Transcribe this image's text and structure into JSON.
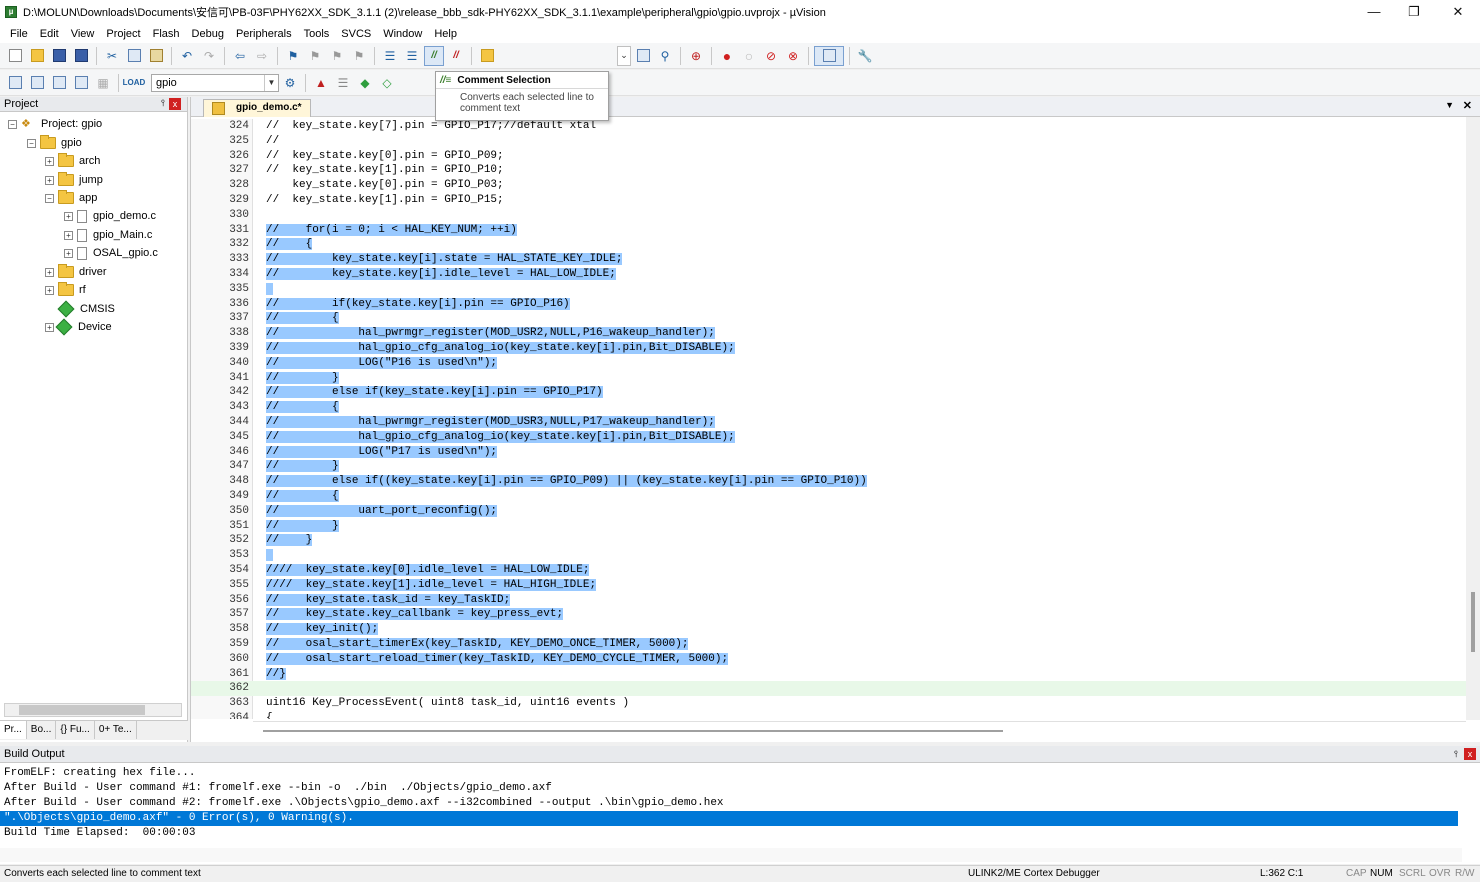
{
  "window": {
    "title": "D:\\MOLUN\\Downloads\\Documents\\安信可\\PB-03F\\PHY62XX_SDK_3.1.1 (2)\\release_bbb_sdk-PHY62XX_SDK_3.1.1\\example\\peripheral\\gpio\\gpio.uvprojx - µVision",
    "minimize": "—",
    "maximize": "❐",
    "close": "✕"
  },
  "menu": [
    "File",
    "Edit",
    "View",
    "Project",
    "Flash",
    "Debug",
    "Peripherals",
    "Tools",
    "SVCS",
    "Window",
    "Help"
  ],
  "toolbar2": {
    "target": "gpio"
  },
  "tooltip": {
    "icon": "//≡",
    "title": "Comment Selection",
    "body_line1": "Converts each selected line to",
    "body_line2": "comment text"
  },
  "project_panel": {
    "title": "Project",
    "pin": "⫯",
    "close": "x",
    "tree": [
      {
        "label": "Project: gpio",
        "level": 0
      },
      {
        "label": "gpio",
        "level": 1
      },
      {
        "label": "arch",
        "level": 2
      },
      {
        "label": "jump",
        "level": 2
      },
      {
        "label": "app",
        "level": 2
      },
      {
        "label": "gpio_demo.c",
        "level": 3
      },
      {
        "label": "gpio_Main.c",
        "level": 3
      },
      {
        "label": "OSAL_gpio.c",
        "level": 3
      },
      {
        "label": "driver",
        "level": 2
      },
      {
        "label": "rf",
        "level": 2
      },
      {
        "label": "CMSIS",
        "level": 2
      },
      {
        "label": "Device",
        "level": 2
      }
    ],
    "tabs": [
      "Pr...",
      "Bo...",
      "{} Fu...",
      "0+ Te..."
    ]
  },
  "editor": {
    "tab_label": "gpio_demo.c*",
    "lines": [
      {
        "n": "324",
        "pre": "//  key_state.key[7].pin = GPIO_P17;//default xtal",
        "sel": ""
      },
      {
        "n": "325",
        "pre": "//",
        "sel": ""
      },
      {
        "n": "326",
        "pre": "//  key_state.key[0].pin = GPIO_P09;",
        "sel": ""
      },
      {
        "n": "327",
        "pre": "//  key_state.key[1].pin = GPIO_P10;",
        "sel": ""
      },
      {
        "n": "328",
        "pre": "    key_state.key[0].pin = GPIO_P03;",
        "sel": ""
      },
      {
        "n": "329",
        "pre": "//  key_state.key[1].pin = GPIO_P15;",
        "sel": ""
      },
      {
        "n": "330",
        "pre": "",
        "sel": ""
      },
      {
        "n": "331",
        "pre": "",
        "sel": "//    for(i = 0; i < HAL_KEY_NUM; ++i)"
      },
      {
        "n": "332",
        "pre": "",
        "sel": "//    {"
      },
      {
        "n": "333",
        "pre": "",
        "sel": "//        key_state.key[i].state = HAL_STATE_KEY_IDLE;"
      },
      {
        "n": "334",
        "pre": "",
        "sel": "//        key_state.key[i].idle_level = HAL_LOW_IDLE;"
      },
      {
        "n": "335",
        "pre": "",
        "sel": " "
      },
      {
        "n": "336",
        "pre": "",
        "sel": "//        if(key_state.key[i].pin == GPIO_P16)"
      },
      {
        "n": "337",
        "pre": "",
        "sel": "//        {"
      },
      {
        "n": "338",
        "pre": "",
        "sel": "//            hal_pwrmgr_register(MOD_USR2,NULL,P16_wakeup_handler);"
      },
      {
        "n": "339",
        "pre": "",
        "sel": "//            hal_gpio_cfg_analog_io(key_state.key[i].pin,Bit_DISABLE);"
      },
      {
        "n": "340",
        "pre": "",
        "sel": "//            LOG(\"P16 is used\\n\");"
      },
      {
        "n": "341",
        "pre": "",
        "sel": "//        }"
      },
      {
        "n": "342",
        "pre": "",
        "sel": "//        else if(key_state.key[i].pin == GPIO_P17)"
      },
      {
        "n": "343",
        "pre": "",
        "sel": "//        {"
      },
      {
        "n": "344",
        "pre": "",
        "sel": "//            hal_pwrmgr_register(MOD_USR3,NULL,P17_wakeup_handler);"
      },
      {
        "n": "345",
        "pre": "",
        "sel": "//            hal_gpio_cfg_analog_io(key_state.key[i].pin,Bit_DISABLE);"
      },
      {
        "n": "346",
        "pre": "",
        "sel": "//            LOG(\"P17 is used\\n\");"
      },
      {
        "n": "347",
        "pre": "",
        "sel": "//        }"
      },
      {
        "n": "348",
        "pre": "",
        "sel": "//        else if((key_state.key[i].pin == GPIO_P09) || (key_state.key[i].pin == GPIO_P10))"
      },
      {
        "n": "349",
        "pre": "",
        "sel": "//        {"
      },
      {
        "n": "350",
        "pre": "",
        "sel": "//            uart_port_reconfig();"
      },
      {
        "n": "351",
        "pre": "",
        "sel": "//        }"
      },
      {
        "n": "352",
        "pre": "",
        "sel": "//    }"
      },
      {
        "n": "353",
        "pre": "",
        "sel": " "
      },
      {
        "n": "354",
        "pre": "",
        "sel": "////  key_state.key[0].idle_level = HAL_LOW_IDLE;"
      },
      {
        "n": "355",
        "pre": "",
        "sel": "////  key_state.key[1].idle_level = HAL_HIGH_IDLE;"
      },
      {
        "n": "356",
        "pre": "",
        "sel": "//    key_state.task_id = key_TaskID;"
      },
      {
        "n": "357",
        "pre": "",
        "sel": "//    key_state.key_callbank = key_press_evt;"
      },
      {
        "n": "358",
        "pre": "",
        "sel": "//    key_init();"
      },
      {
        "n": "359",
        "pre": "",
        "sel": "//    osal_start_timerEx(key_TaskID, KEY_DEMO_ONCE_TIMER, 5000);"
      },
      {
        "n": "360",
        "pre": "",
        "sel": "//    osal_start_reload_timer(key_TaskID, KEY_DEMO_CYCLE_TIMER, 5000);"
      },
      {
        "n": "361",
        "pre": "",
        "sel": "//}"
      },
      {
        "n": "362",
        "pre": "",
        "sel": ""
      },
      {
        "n": "363",
        "pre": "uint16 Key_ProcessEvent( uint8 task_id, uint16 events )",
        "sel": ""
      },
      {
        "n": "364",
        "pre": "{",
        "sel": ""
      }
    ]
  },
  "build_output": {
    "title": "Build Output",
    "lines": [
      "FromELF: creating hex file...",
      "After Build - User command #1: fromelf.exe --bin -o  ./bin  ./Objects/gpio_demo.axf",
      "After Build - User command #2: fromelf.exe .\\Objects\\gpio_demo.axf --i32combined --output .\\bin\\gpio_demo.hex",
      "\".\\Objects\\gpio_demo.axf\" - 0 Error(s), 0 Warning(s).",
      "Build Time Elapsed:  00:00:03"
    ]
  },
  "status": {
    "message": "Converts each selected line to comment text",
    "debugger": "ULINK2/ME Cortex Debugger",
    "position": "L:362 C:1",
    "cap": "CAP",
    "num": "NUM",
    "scrl": "SCRL",
    "ovr": "OVR",
    "rw": "R/W"
  },
  "colors": {
    "selection": "#99c9ff",
    "build_highlight": "#0078d7",
    "current_line": "#e8f8e8"
  }
}
